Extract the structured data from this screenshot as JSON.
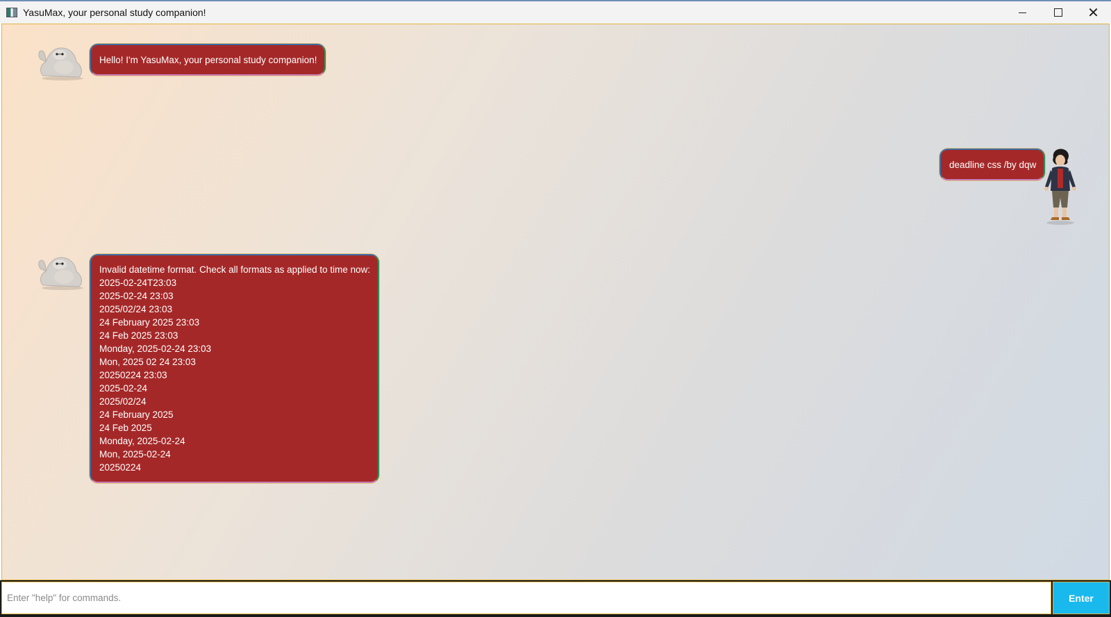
{
  "window": {
    "title": "YasuMax, your personal study companion!"
  },
  "titlebar": {
    "minimize_icon": "minimize-icon",
    "maximize_icon": "maximize-icon",
    "close_icon": "close-icon"
  },
  "messages": [
    {
      "sender": "bot",
      "lines": [
        "Hello! I'm YasuMax, your personal study companion!"
      ]
    },
    {
      "sender": "user",
      "lines": [
        "deadline css /by dqw"
      ]
    },
    {
      "sender": "bot",
      "lines": [
        "Invalid datetime format. Check all formats as applied to time now:",
        "2025-02-24T23:03",
        "2025-02-24 23:03",
        "2025/02/24 23:03",
        "24 February 2025 23:03",
        "24 Feb 2025 23:03",
        "Monday, 2025-02-24 23:03",
        "Mon, 2025 02 24 23:03",
        "20250224 23:03",
        "2025-02-24",
        "2025/02/24",
        "24 February 2025",
        "24 Feb 2025",
        "Monday, 2025-02-24",
        "Mon, 2025-02-24",
        "20250224"
      ]
    }
  ],
  "input": {
    "value": "",
    "placeholder": "Enter \"help\" for commands."
  },
  "enter_button": {
    "label": "Enter"
  },
  "colors": {
    "bubble": "#a52828",
    "enter_button": "#19b9ee",
    "border_accent": "#e0b440"
  }
}
